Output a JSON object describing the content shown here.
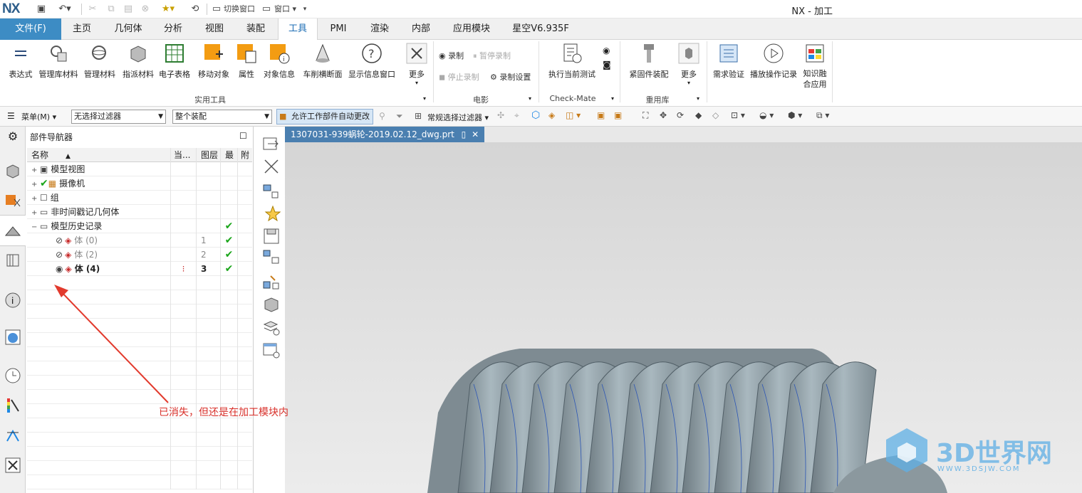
{
  "app": {
    "logo": "NX",
    "title": "NX - 加工"
  },
  "quick_access": {
    "switch_window": "切换窗口",
    "window": "窗口"
  },
  "tabs": [
    {
      "label": "文件(F)"
    },
    {
      "label": "主页"
    },
    {
      "label": "几何体"
    },
    {
      "label": "分析"
    },
    {
      "label": "视图"
    },
    {
      "label": "装配"
    },
    {
      "label": "工具"
    },
    {
      "label": "PMI"
    },
    {
      "label": "渲染"
    },
    {
      "label": "内部"
    },
    {
      "label": "应用模块"
    },
    {
      "label": "星空V6.935F"
    }
  ],
  "ribbon": {
    "utilities": [
      "表达式",
      "管理库材料",
      "管理材料",
      "指派材料",
      "电子表格",
      "移动对象",
      "属性",
      "对象信息",
      "车削横断面",
      "显示信息窗口",
      "更多"
    ],
    "utilities_group": "实用工具",
    "movie": {
      "record": "录制",
      "pause": "暂停录制",
      "stop": "停止录制",
      "settings": "录制设置",
      "group": "电影"
    },
    "checkmate": {
      "run": "执行当前测试",
      "group": "Check-Mate"
    },
    "reuse": {
      "fastener": "紧固件装配",
      "more": "更多",
      "group": "重用库"
    },
    "extra": [
      "需求验证",
      "播放操作记录",
      "知识融合应用"
    ]
  },
  "filterbar": {
    "menu": "菜单(M)",
    "filter": "无选择过滤器",
    "scope": "整个装配",
    "auto_change": "允许工作部件自动更改",
    "type_filter": "常规选择过滤器"
  },
  "navigator": {
    "title": "部件导航器",
    "columns": [
      "名称",
      "当...",
      "图层",
      "最",
      "附"
    ],
    "rows": [
      {
        "name": "模型视图",
        "layer": "",
        "latest": false,
        "dim": false
      },
      {
        "name": "摄像机",
        "layer": "",
        "latest": false,
        "dim": false
      },
      {
        "name": "组",
        "layer": "",
        "latest": false,
        "dim": false
      },
      {
        "name": "非时间戳记几何体",
        "layer": "",
        "latest": false,
        "dim": false
      },
      {
        "name": "模型历史记录",
        "layer": "",
        "latest": true,
        "dim": false
      },
      {
        "name": "体 (0)",
        "layer": "1",
        "latest": true,
        "dim": true
      },
      {
        "name": "体 (2)",
        "layer": "2",
        "latest": true,
        "dim": true
      },
      {
        "name": "体 (4)",
        "layer": "3",
        "latest": true,
        "dim": false
      }
    ]
  },
  "document": {
    "tab": "1307031-939蜗轮-2019.02.12_dwg.prt"
  },
  "annotation": "已消失，但还是在加工模块内",
  "watermark": {
    "brand": "3D世界网",
    "url": "WWW.3DSJW.COM"
  },
  "colors": {
    "file_tab": "#3d8cc4",
    "active_tab_text": "#1e6eb5",
    "annotation": "#d8302a",
    "doc_tab": "#4a7fb0"
  }
}
